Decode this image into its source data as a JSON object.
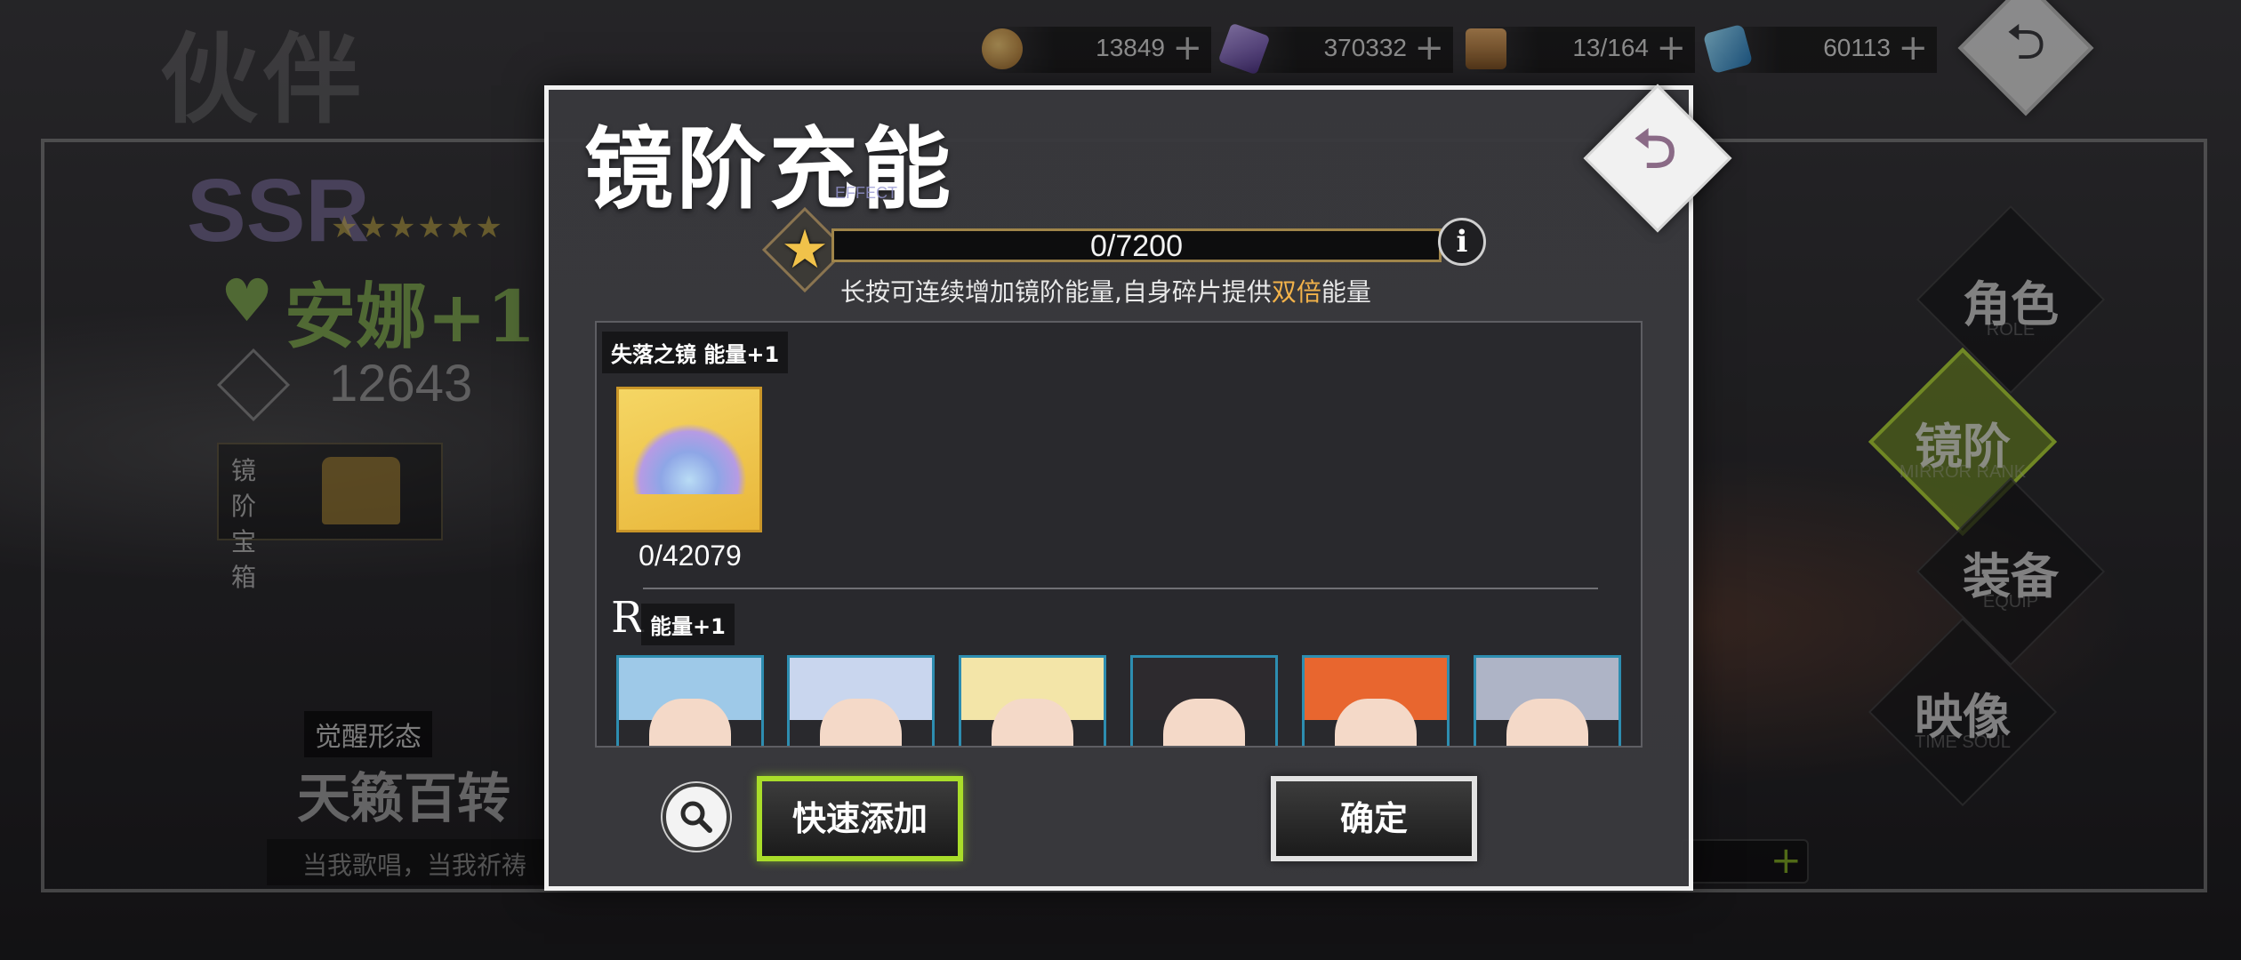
{
  "background": {
    "page_title": "伙伴",
    "resources": [
      {
        "icon": "gold-coin-icon",
        "value": "13849",
        "color": "#c89a4a"
      },
      {
        "icon": "purple-crystal-icon",
        "value": "370332",
        "color": "#8a6fc2"
      },
      {
        "icon": "bread-box-icon",
        "value": "13/164",
        "color": "#c08a4a"
      },
      {
        "icon": "blue-gem-icon",
        "value": "60113",
        "color": "#49a6d8"
      }
    ],
    "rarity": "SSR",
    "stars": "★★★★★★",
    "character_name": "安娜+1",
    "power": "12643",
    "chest_label": "镜阶宝箱",
    "awaken_tag": "觉醒形态",
    "awaken_name": "天籁百转",
    "quote": "当我歌唱，当我祈祷",
    "side_nav": [
      {
        "label": "角色",
        "sub": "ROLE",
        "active": false
      },
      {
        "label": "镜阶",
        "sub": "MIRROR RANK",
        "active": true
      },
      {
        "label": "装备",
        "sub": "EQUIP",
        "active": false
      },
      {
        "label": "映像",
        "sub": "TIME SOUL",
        "active": false
      }
    ]
  },
  "modal": {
    "title": "镜阶充能",
    "title_sub": "EFFECT",
    "energy": {
      "current": 0,
      "max": 7200,
      "text": "0/7200"
    },
    "info_label": "i",
    "hint_prefix": "长按可连续增加镜阶能量,自身碎片提供",
    "hint_highlight": "双倍",
    "hint_suffix": "能量",
    "mirror_section": {
      "label": "失落之镜  能量+1",
      "item_count": "0/42079"
    },
    "r_section": {
      "rarity": "R",
      "label": "能量+1"
    },
    "portraits": [
      {
        "hair": "#9ec9e8"
      },
      {
        "hair": "#c9d6ee"
      },
      {
        "hair": "#f3e5a8"
      },
      {
        "hair": "#2d2a2e"
      },
      {
        "hair": "#e8662f"
      },
      {
        "hair": "#aeb4c6"
      }
    ],
    "quick_add_label": "快速添加",
    "confirm_label": "确定",
    "colors": {
      "accent_green": "#a9dd2a",
      "highlight_orange": "#f2b24a",
      "bar_border": "#a0854a"
    }
  }
}
